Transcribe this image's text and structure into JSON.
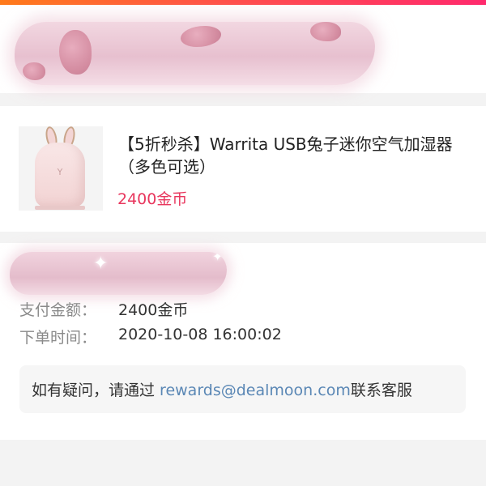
{
  "product": {
    "title": "【5折秒杀】Warrita USB兔子迷你空气加湿器（多色可选）",
    "price": "2400金币",
    "image_name": "rabbit-humidifier-image"
  },
  "order": {
    "payment_label": "支付金额：",
    "payment_value": "2400金币",
    "time_label": "下单时间：",
    "time_value": "2020-10-08 16:00:02"
  },
  "contact": {
    "prefix": "如有疑问，请通过 ",
    "email": "rewards@dealmoon.com",
    "suffix": "联系客服"
  },
  "colors": {
    "accent_price": "#e8365d",
    "link": "#5a87b5",
    "top_bar_start": "#ff7a1a",
    "top_bar_end": "#ff2a6d"
  }
}
